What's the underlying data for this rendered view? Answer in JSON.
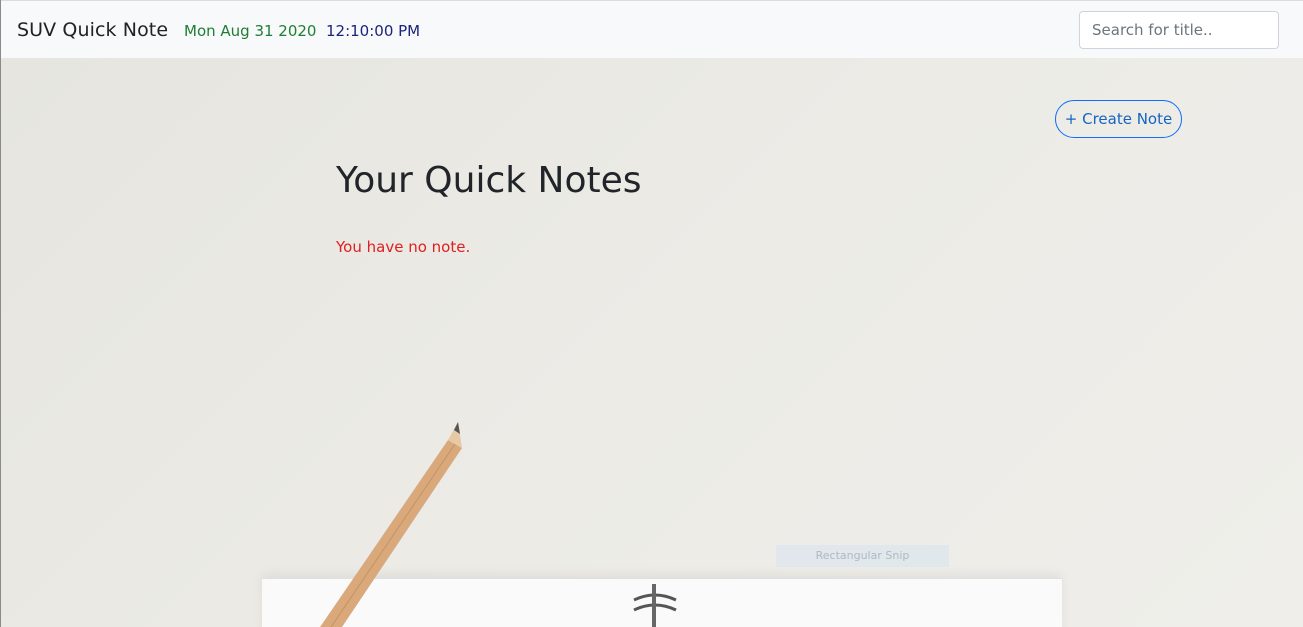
{
  "navbar": {
    "brand": "SUV Quick Note",
    "date": "Mon Aug 31 2020",
    "time": "12:10:00 PM",
    "search_placeholder": "Search for title.."
  },
  "main": {
    "create_button": "+ Create Note",
    "title": "Your Quick Notes",
    "empty_message": "You have no note."
  },
  "overlay": {
    "snip_tooltip": "Rectangular Snip"
  },
  "colors": {
    "date": "#1e7e34",
    "time": "#1a237e",
    "accent": "#0d6efd",
    "empty_message": "#e02020"
  }
}
